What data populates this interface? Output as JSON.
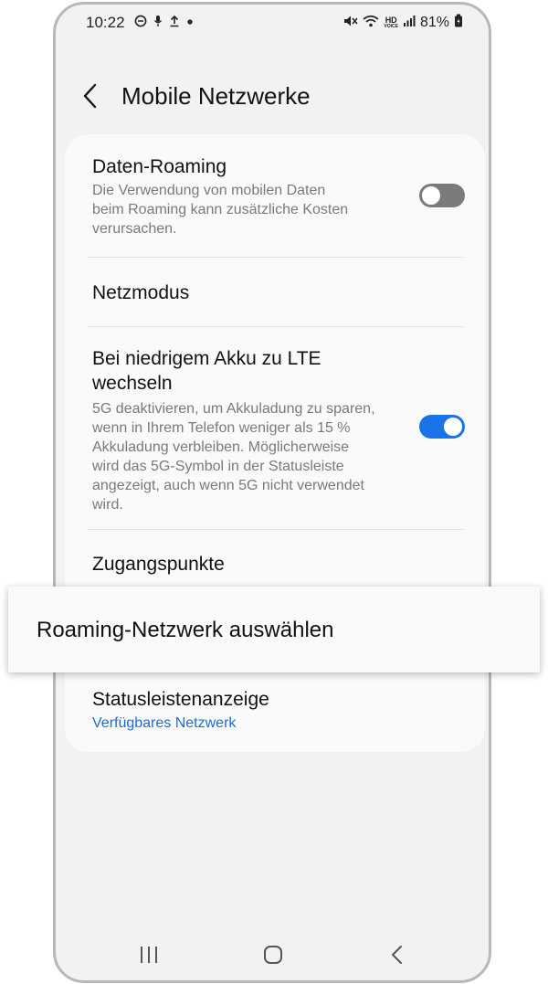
{
  "status_bar": {
    "time": "10:22",
    "battery": "81%",
    "hd_label_top": "HD",
    "hd_label_bottom": "VOICE"
  },
  "header": {
    "title": "Mobile Netzwerke",
    "back_icon": "chevron-left-icon"
  },
  "settings": {
    "data_roaming": {
      "title": "Daten-Roaming",
      "subtitle_lines": [
        "Die Verwendung von mobilen Daten",
        "beim Roaming kann zusätzliche Kosten",
        "verursachen."
      ],
      "enabled": false
    },
    "network_mode": {
      "title": "Netzmodus"
    },
    "lte_low_battery": {
      "title_lines": [
        "Bei niedrigem Akku zu LTE",
        "wechseln"
      ],
      "subtitle_lines": [
        "5G deaktivieren, um Akkuladung zu sparen,",
        "wenn in Ihrem Telefon weniger als 15 %",
        "Akkuladung verbleiben. Möglicherweise",
        "wird das 5G-Symbol in der Statusleiste",
        "angezeigt, auch wenn 5G nicht verwendet",
        "wird."
      ],
      "enabled": true
    },
    "access_points": {
      "title": "Zugangspunkte"
    },
    "status_bar_display": {
      "title": "Statusleistenanzeige",
      "value": "Verfügbares Netzwerk"
    }
  },
  "highlight_popup": {
    "label": "Roaming-Netzwerk auswählen"
  },
  "nav_bar": {
    "recents_icon": "recents-icon",
    "home_icon": "home-icon",
    "back_icon": "back-icon"
  },
  "colors": {
    "accent": "#1a73e8",
    "link": "#1a6dd6",
    "toggle_off": "#7b7b7b"
  }
}
